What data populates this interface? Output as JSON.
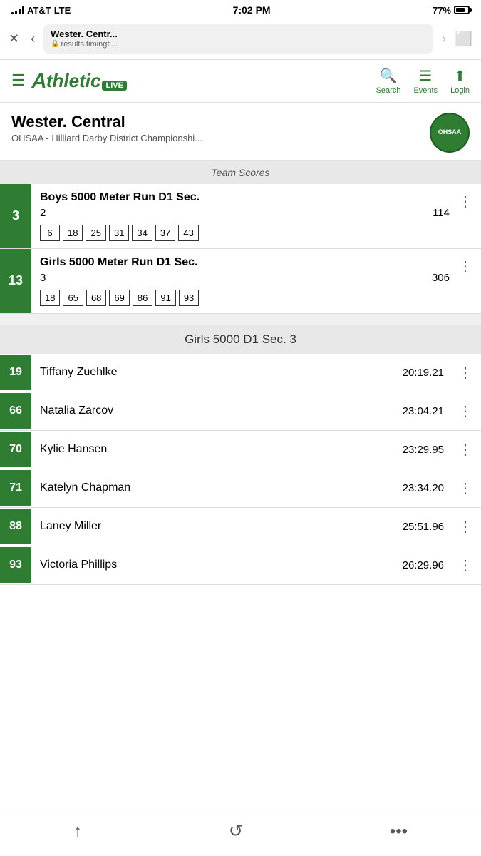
{
  "statusBar": {
    "carrier": "AT&T",
    "network": "LTE",
    "time": "7:02 PM",
    "battery": "77%"
  },
  "browser": {
    "title": "Wester. Centr...",
    "url": "results.timingfi...",
    "forwardDisabled": true
  },
  "header": {
    "logoText": "thletic",
    "liveLabel": "LIVE",
    "search": "Search",
    "events": "Events",
    "login": "Login"
  },
  "page": {
    "title": "Wester. Central",
    "subtitle": "OHSAA - Hilliard Darby District Championshi...",
    "ohsaaLabel": "OHSAA"
  },
  "teamScoresSection": {
    "title": "Team Scores"
  },
  "teamScores": [
    {
      "rank": "3",
      "eventName": "Boys 5000 Meter Run D1 Sec.",
      "section": "2",
      "score": "114",
      "places": [
        "6",
        "18",
        "25",
        "31",
        "34",
        "37",
        "43"
      ]
    },
    {
      "rank": "13",
      "eventName": "Girls 5000 Meter Run D1 Sec.",
      "section": "3",
      "score": "306",
      "places": [
        "18",
        "65",
        "68",
        "69",
        "86",
        "91",
        "93"
      ]
    }
  ],
  "eventSection": {
    "title": "Girls 5000 D1 Sec. 3"
  },
  "results": [
    {
      "bib": "19",
      "name": "Tiffany Zuehlke",
      "time": "20:19.21"
    },
    {
      "bib": "66",
      "name": "Natalia Zarcov",
      "time": "23:04.21"
    },
    {
      "bib": "70",
      "name": "Kylie Hansen",
      "time": "23:29.95"
    },
    {
      "bib": "71",
      "name": "Katelyn Chapman",
      "time": "23:34.20"
    },
    {
      "bib": "88",
      "name": "Laney Miller",
      "time": "25:51.96"
    },
    {
      "bib": "93",
      "name": "Victoria Phillips",
      "time": "26:29.96"
    }
  ],
  "bottomNav": {
    "shareLabel": "share",
    "refreshLabel": "refresh",
    "moreLabel": "more"
  }
}
